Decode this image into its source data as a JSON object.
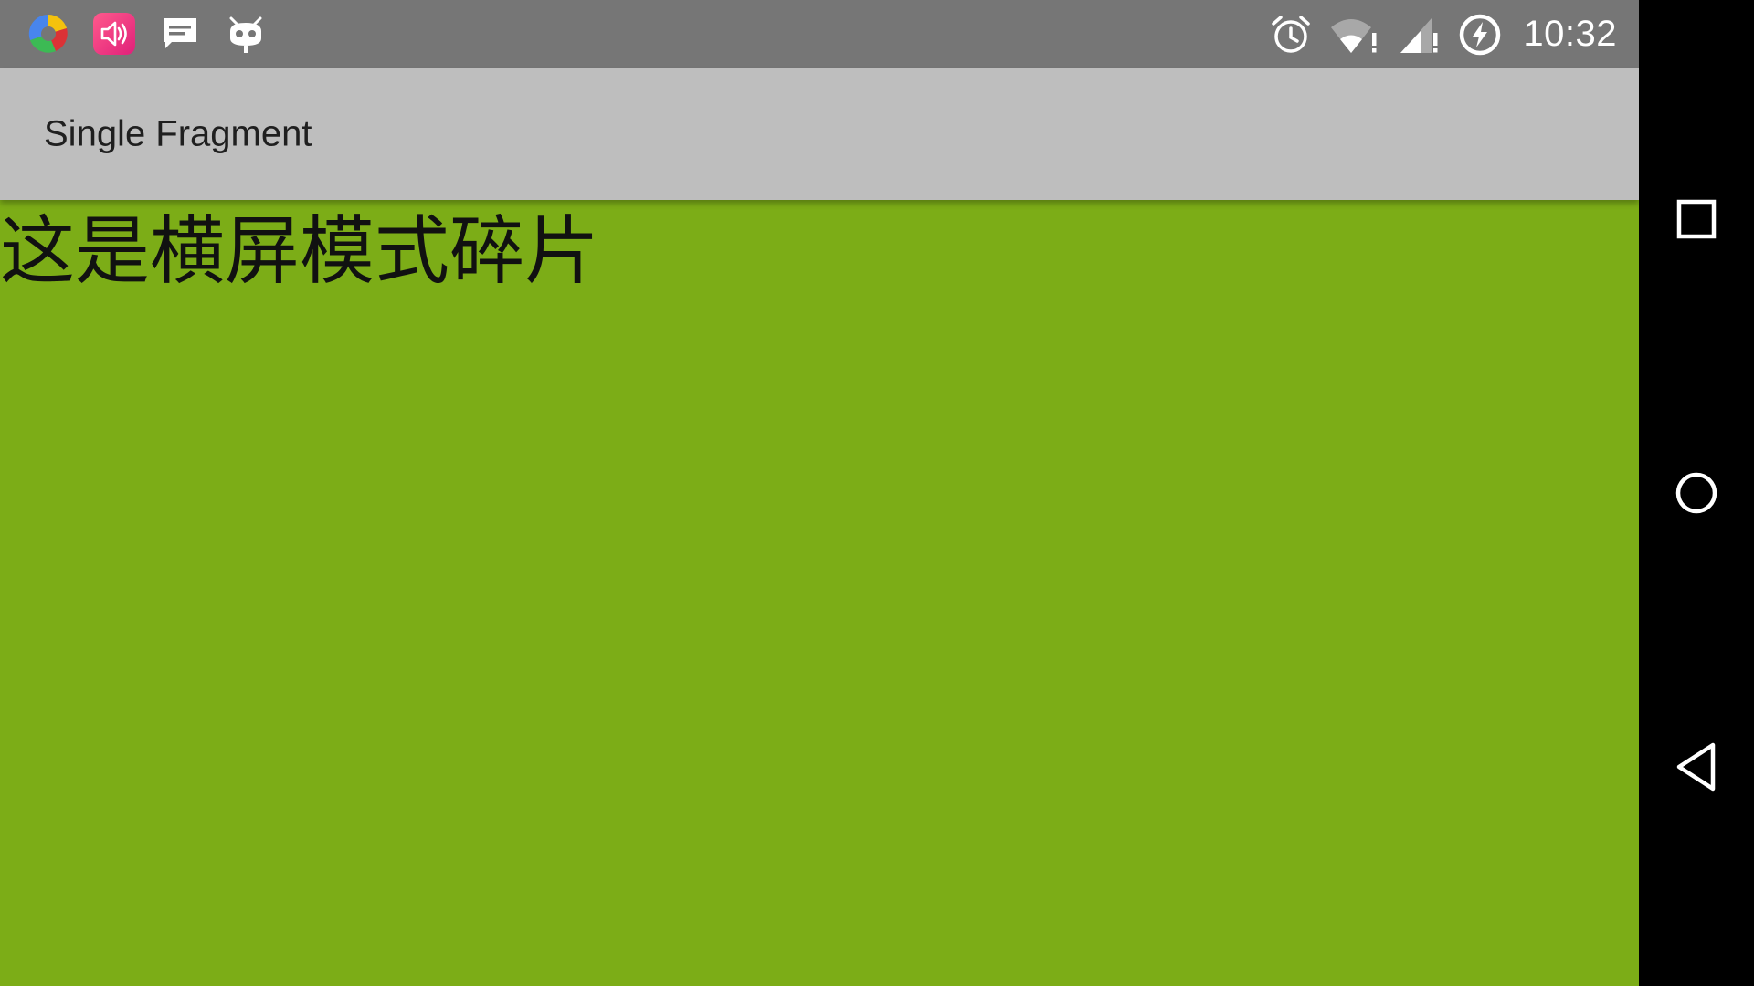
{
  "status_bar": {
    "time": "10:32",
    "left_icons": [
      "color-circle-icon",
      "speaker-icon",
      "message-icon",
      "android-cat-icon"
    ],
    "right_icons": [
      "alarm-icon",
      "wifi-alert-icon",
      "signal-alert-icon",
      "battery-charging-icon"
    ]
  },
  "toolbar": {
    "title": "Single Fragment"
  },
  "content": {
    "fragment_text": "这是横屏模式碎片",
    "background": "#7cad17"
  },
  "nav_bar": {
    "buttons": [
      "recents",
      "home",
      "back"
    ]
  },
  "colors": {
    "status_bar": "#767676",
    "toolbar": "#bebebe",
    "accent_green": "#7cad17"
  }
}
